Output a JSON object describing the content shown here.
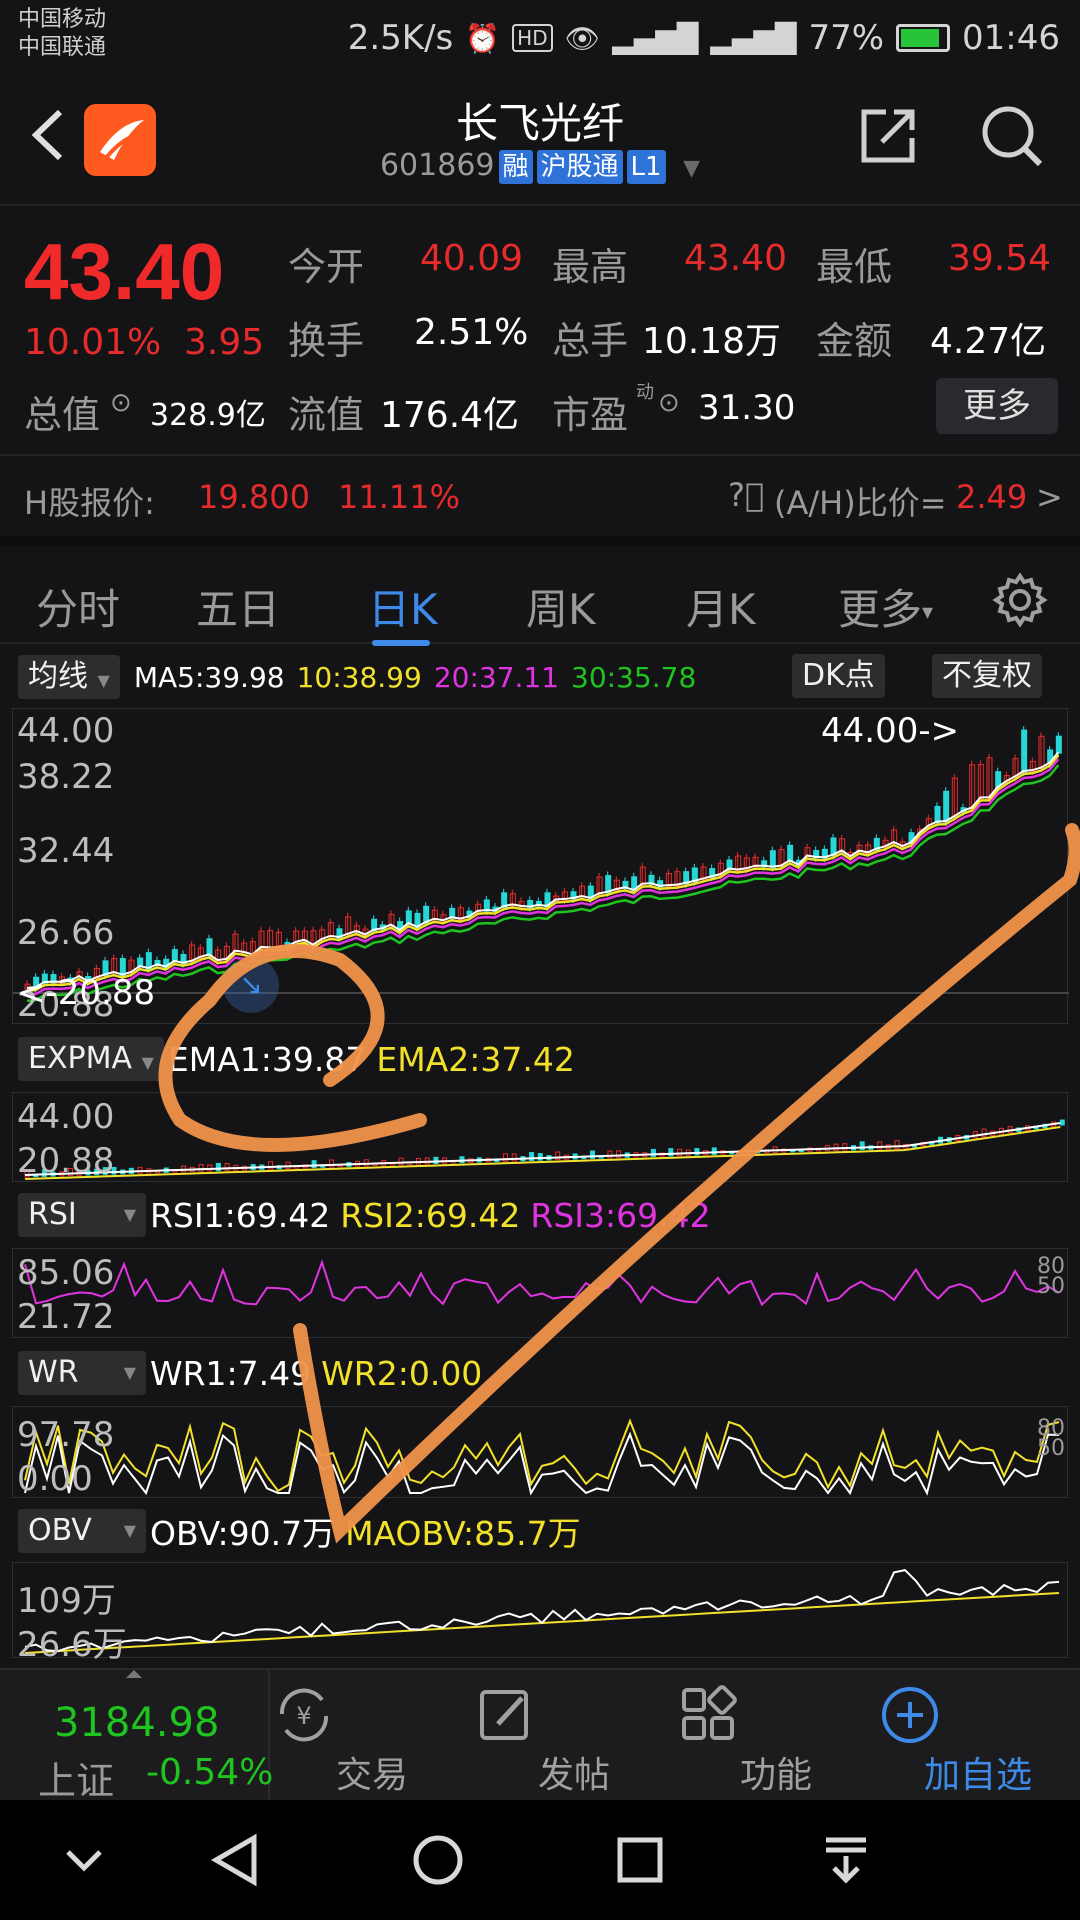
{
  "status_bar": {
    "carrier1": "中国移动",
    "carrier2": "中国联通",
    "speed": "2.5K/s",
    "battery": "77%",
    "time": "01:46"
  },
  "header": {
    "title": "长飞光纤",
    "code": "601869",
    "tags": [
      "融",
      "沪股通",
      "L1"
    ]
  },
  "quote": {
    "price": "43.40",
    "change_pct": "10.01%",
    "change": "3.95",
    "stats": [
      {
        "label": "今开",
        "value": "40.09",
        "color": "red"
      },
      {
        "label": "最高",
        "value": "43.40",
        "color": "red"
      },
      {
        "label": "最低",
        "value": "39.54",
        "color": "red"
      },
      {
        "label": "换手",
        "value": "2.51%",
        "color": "white"
      },
      {
        "label": "总手",
        "value": "10.18万",
        "color": "white"
      },
      {
        "label": "金额",
        "value": "4.27亿",
        "color": "white"
      }
    ],
    "total_value_label": "总值",
    "total_value": "328.9亿",
    "float_value_label": "流值",
    "float_value": "176.4亿",
    "pe_label": "市盈",
    "pe_sup": "动",
    "pe": "31.30",
    "more_label": "更多",
    "h_label": "H股报价:",
    "h_price": "19.800",
    "h_pct": "11.11%",
    "ah_label": "(A/H)比价=",
    "ah_value": "2.49",
    "ah_arrow": ">"
  },
  "tabs": [
    {
      "label": "分时",
      "active": false
    },
    {
      "label": "五日",
      "active": false
    },
    {
      "label": "日K",
      "active": true
    },
    {
      "label": "周K",
      "active": false
    },
    {
      "label": "月K",
      "active": false
    },
    {
      "label": "更多",
      "active": false
    }
  ],
  "chart": {
    "ma_selector": "均线",
    "ma5": "MA5:39.98",
    "ma10": "10:38.99",
    "ma20": "20:37.11",
    "ma30": "30:35.78",
    "dk_button": "DK点",
    "adjust_button": "不复权",
    "price_axis": [
      "44.00",
      "38.22",
      "32.44",
      "26.66",
      "20.88"
    ],
    "high_marker": "44.00->",
    "low_marker": "<-20.88",
    "colors": {
      "ma5": "#ffffff",
      "ma10": "#f2e12a",
      "ma20": "#e034e0",
      "ma30": "#1fc41f"
    }
  },
  "indicators": {
    "expma": {
      "selector": "EXPMA",
      "ema1": "EMA1:39.87",
      "ema2": "EMA2:37.42",
      "axis": [
        "44.00",
        "20.88"
      ]
    },
    "rsi": {
      "selector": "RSI",
      "rsi1": "RSI1:69.42",
      "rsi2": "RSI2:69.42",
      "rsi3": "RSI3:69.42",
      "axis": [
        "85.06",
        "21.72"
      ],
      "right_axis": [
        "80",
        "50"
      ]
    },
    "wr": {
      "selector": "WR",
      "wr1": "WR1:7.49",
      "wr2": "WR2:0.00",
      "axis": [
        "97.78",
        "0.00"
      ],
      "right_axis": [
        "80",
        "50"
      ]
    },
    "obv": {
      "selector": "OBV",
      "obv": "OBV:90.7万",
      "maobv": "MAOBV:85.7万",
      "axis": [
        "109万",
        "26.6万"
      ]
    }
  },
  "bottom_bar": {
    "index_value": "3184.98",
    "index_name": "上证",
    "index_change": "-0.54%",
    "items": [
      {
        "label": "交易",
        "icon": "yen-refresh-icon"
      },
      {
        "label": "发帖",
        "icon": "edit-icon"
      },
      {
        "label": "功能",
        "icon": "grid-icon"
      },
      {
        "label": "加自选",
        "icon": "plus-circle-icon"
      }
    ]
  }
}
